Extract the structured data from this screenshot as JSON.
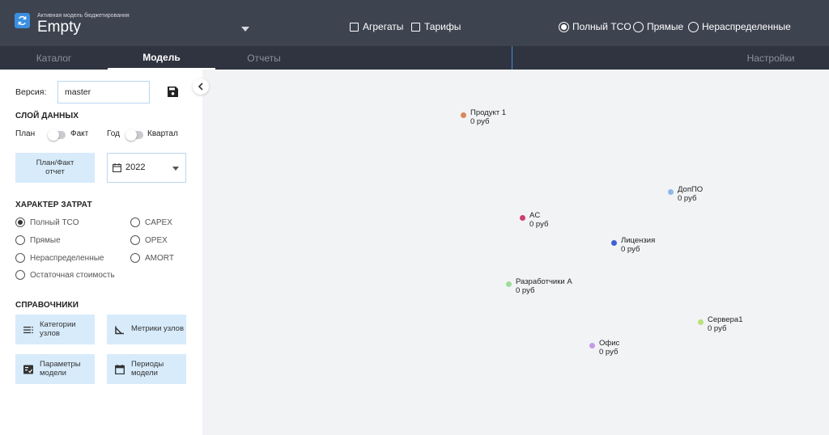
{
  "header": {
    "subtitle": "Активная модель бюджетирования",
    "model_name": "Empty",
    "checkboxes": [
      {
        "label": "Агрегаты",
        "checked": false
      },
      {
        "label": "Тарифы",
        "checked": false
      }
    ],
    "cost_mode": [
      {
        "label": "Полный TCO",
        "selected": true
      },
      {
        "label": "Прямые",
        "selected": false
      },
      {
        "label": "Нераспределенные",
        "selected": false
      }
    ]
  },
  "nav": {
    "tabs": [
      {
        "label": "Каталог",
        "active": false
      },
      {
        "label": "Модель",
        "active": true
      },
      {
        "label": "Отчеты",
        "active": false
      },
      {
        "label": "Настройки",
        "active": false
      }
    ]
  },
  "left": {
    "version_label": "Версия:",
    "version_value": "master",
    "data_layer_title": "СЛОЙ ДАННЫХ",
    "plan_label": "План",
    "fact_label": "Факт",
    "year_label": "Год",
    "quarter_label": "Квартал",
    "plan_fact_button": "План/Факт отчет",
    "year_value": "2022",
    "cost_nature_title": "ХАРАКТЕР ЗАТРАТ",
    "cost_options_left": [
      "Полный TCO",
      "Прямые",
      "Нераспределенные",
      "Остаточная стоимость"
    ],
    "cost_options_right": [
      "CAPEX",
      "OPEX",
      "AMORT"
    ],
    "selected_cost_option": "Полный TCO",
    "refs_title": "СПРАВОЧНИКИ",
    "refs": [
      {
        "label": "Категории узлов",
        "icon": "list-icon"
      },
      {
        "label": "Метрики узлов",
        "icon": "angle-icon"
      },
      {
        "label": "Параметры модели",
        "icon": "params-icon"
      },
      {
        "label": "Периоды модели",
        "icon": "calendar-icon"
      }
    ]
  },
  "graph": {
    "nodes": [
      {
        "name": "Продукт 1",
        "value": "0 руб",
        "color": "#d9875a"
      },
      {
        "name": "ДопПО",
        "value": "0 руб",
        "color": "#8db8e8"
      },
      {
        "name": "AC",
        "value": "0 руб",
        "color": "#cf3d6a"
      },
      {
        "name": "Лицензия",
        "value": "0 руб",
        "color": "#3e5fd6"
      },
      {
        "name": "Разработчики А",
        "value": "0 руб",
        "color": "#9edc9a"
      },
      {
        "name": "Сервера1",
        "value": "0 руб",
        "color": "#b7e07e"
      },
      {
        "name": "Офис",
        "value": "0 руб",
        "color": "#c79ae6"
      }
    ]
  },
  "colors": {
    "header_bg": "#3e4350",
    "nav_bg": "#2f3440",
    "accent": "#3b8fe0",
    "button_bg": "#d7ebfb"
  }
}
